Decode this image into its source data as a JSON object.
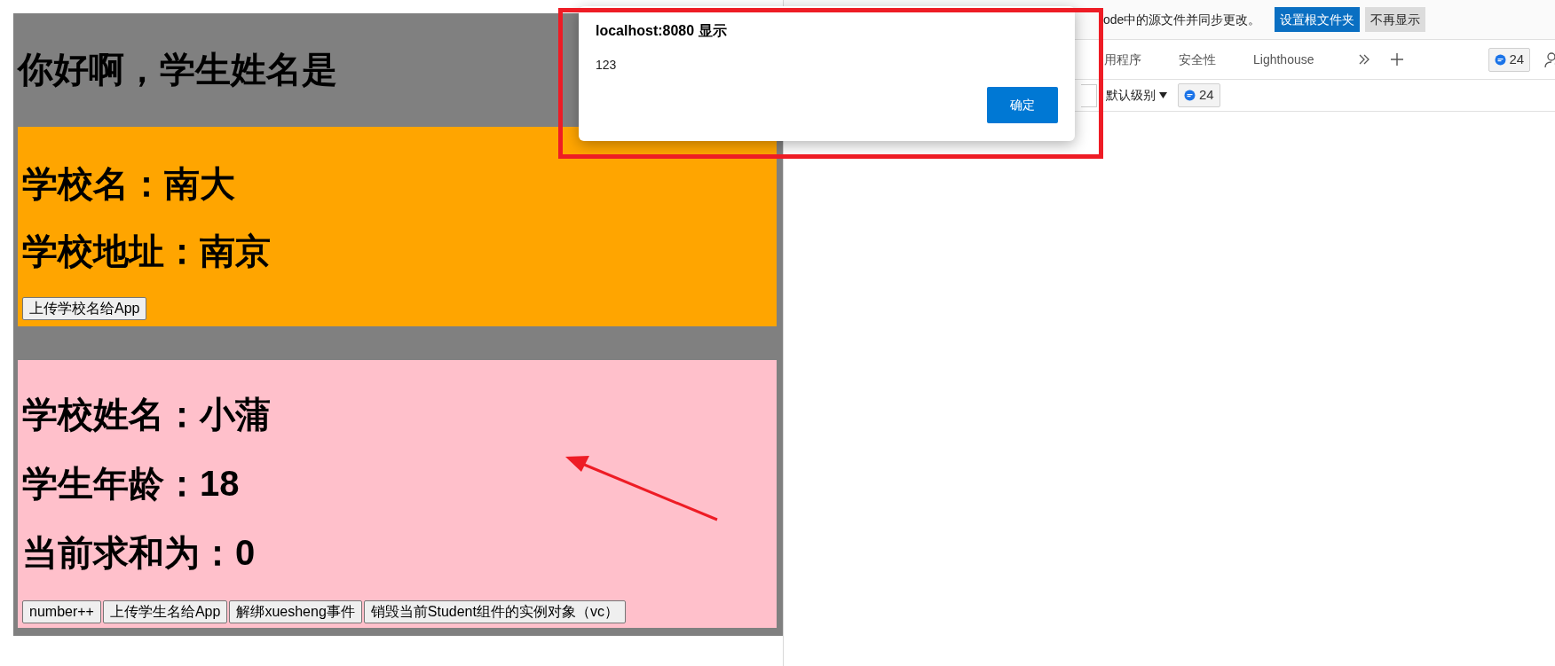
{
  "app": {
    "greeting": "你好啊，学生姓名是",
    "school": {
      "lines": [
        "学校名：南大",
        "学校地址：南京"
      ],
      "buttons": [
        "上传学校名给App"
      ]
    },
    "student": {
      "lines": [
        "学校姓名：小蒲",
        "学生年龄：18",
        "当前求和为：0"
      ],
      "buttons": [
        "number++",
        "上传学生名给App",
        "解绑xuesheng事件",
        "销毁当前Student组件的实例对象（vc）"
      ]
    }
  },
  "devtools": {
    "infobar": {
      "text": "ode中的源文件并同步更改。",
      "buttons": [
        {
          "label": "设置根文件夹",
          "kind": "primary"
        },
        {
          "label": "不再显示",
          "kind": "secondary"
        }
      ]
    },
    "tabs": [
      {
        "label": "用程序",
        "selected": false
      },
      {
        "label": "安全性",
        "selected": false
      },
      {
        "label": "Lighthouse",
        "selected": false
      }
    ],
    "issues_count": "24",
    "console_toolbar": {
      "level_filter": "默认级别",
      "issues_count": "24"
    }
  },
  "alert": {
    "title": "localhost:8080 显示",
    "message": "123",
    "ok_button": "确定"
  }
}
